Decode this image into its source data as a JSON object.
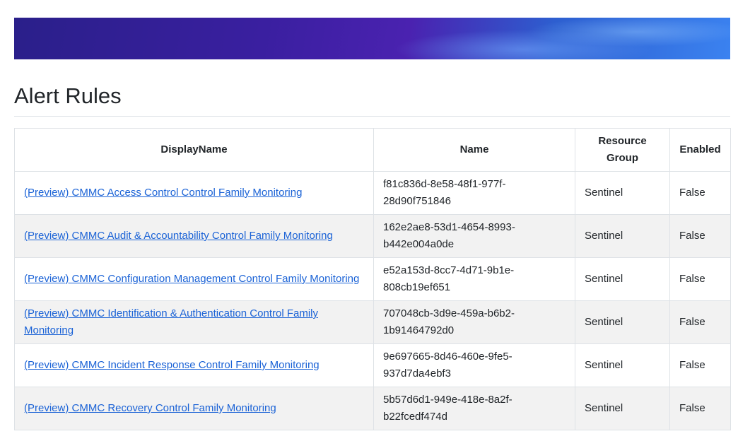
{
  "page": {
    "title": "Alert Rules"
  },
  "table": {
    "headers": [
      "DisplayName",
      "Name",
      "Resource Group",
      "Enabled"
    ],
    "rows": [
      {
        "display_name": "(Preview) CMMC Access Control Control Family Monitoring",
        "name": "f81c836d-8e58-48f1-977f-28d90f751846",
        "resource_group": "Sentinel",
        "enabled": "False"
      },
      {
        "display_name": "(Preview) CMMC Audit & Accountability Control Family Monitoring",
        "name": "162e2ae8-53d1-4654-8993-b442e004a0de",
        "resource_group": "Sentinel",
        "enabled": "False"
      },
      {
        "display_name": "(Preview) CMMC Configuration Management Control Family Monitoring",
        "name": "e52a153d-8cc7-4d71-9b1e-808cb19ef651",
        "resource_group": "Sentinel",
        "enabled": "False"
      },
      {
        "display_name": "(Preview) CMMC Identification & Authentication Control Family Monitoring",
        "name": "707048cb-3d9e-459a-b6b2-1b91464792d0",
        "resource_group": "Sentinel",
        "enabled": "False"
      },
      {
        "display_name": "(Preview) CMMC Incident Response Control Family Monitoring",
        "name": "9e697665-8d46-460e-9fe5-937d7da4ebf3",
        "resource_group": "Sentinel",
        "enabled": "False"
      },
      {
        "display_name": "(Preview) CMMC Recovery Control Family Monitoring",
        "name": "5b57d6d1-949e-418e-8a2f-b22fcedf474d",
        "resource_group": "Sentinel",
        "enabled": "False"
      }
    ]
  },
  "colors": {
    "link": "#1a62d6",
    "stripe": "#f2f2f2",
    "border": "#dee2e6"
  }
}
